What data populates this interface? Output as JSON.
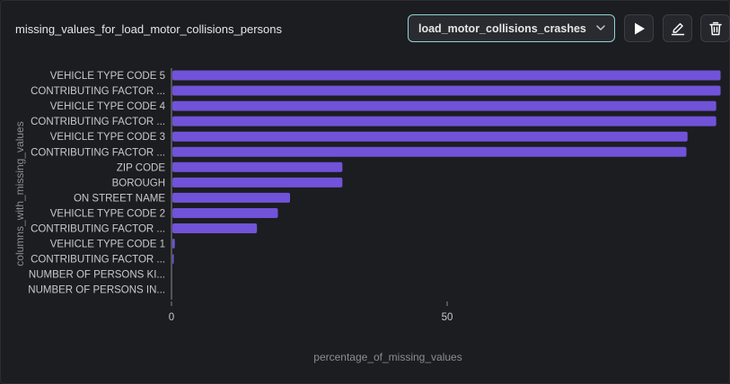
{
  "header": {
    "title": "missing_values_for_load_motor_collisions_persons",
    "dataset_select": {
      "value": "load_motor_collisions_crashes",
      "icon": "chevron-down-icon"
    },
    "actions": [
      {
        "name": "run-button",
        "icon": "play-icon"
      },
      {
        "name": "edit-button",
        "icon": "pencil-icon"
      },
      {
        "name": "delete-button",
        "icon": "trash-icon"
      }
    ]
  },
  "colors": {
    "bar": "#7053d8",
    "select_border": "#8fd3d3",
    "background": "#1c1d21"
  },
  "chart_data": {
    "type": "bar",
    "orientation": "horizontal",
    "categories": [
      "VEHICLE TYPE CODE 5",
      "CONTRIBUTING FACTOR ...",
      "VEHICLE TYPE CODE 4",
      "CONTRIBUTING FACTOR ...",
      "VEHICLE TYPE CODE 3",
      "CONTRIBUTING FACTOR ...",
      "ZIP CODE",
      "BOROUGH",
      "ON STREET NAME",
      "VEHICLE TYPE CODE 2",
      "CONTRIBUTING FACTOR ...",
      "VEHICLE TYPE CODE 1",
      "CONTRIBUTING FACTOR ...",
      "NUMBER OF PERSONS KI...",
      "NUMBER OF PERSONS IN..."
    ],
    "values": [
      99.6,
      99.6,
      98.8,
      98.8,
      93.6,
      93.4,
      31.0,
      31.0,
      21.5,
      19.3,
      15.5,
      0.6,
      0.3,
      0.0,
      0.0
    ],
    "xlabel": "percentage_of_missing_values",
    "ylabel": "columns_with_missing_values",
    "xticks": [
      0,
      50
    ],
    "xlim": [
      0,
      100
    ],
    "grid": false,
    "legend": "none"
  }
}
